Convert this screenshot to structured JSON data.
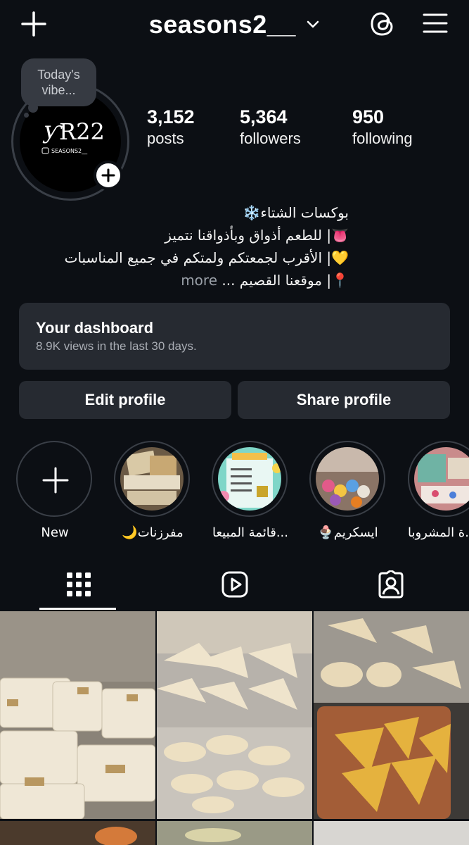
{
  "header": {
    "username": "seasons2__",
    "icons": [
      "plus-icon",
      "chevron-down-icon",
      "threads-icon",
      "menu-icon"
    ]
  },
  "profile": {
    "note": "Today's vibe...",
    "logo_text": "R22",
    "logo_subtext": "SEASONS2__",
    "stats": [
      {
        "value": "3,152",
        "label": "posts"
      },
      {
        "value": "5,364",
        "label": "followers"
      },
      {
        "value": "950",
        "label": "following"
      }
    ]
  },
  "bio": {
    "line1": "بوكسات الشتاء❄️",
    "line2": "👅| للطعم أذواق وبأذواقنا نتميز",
    "line3": "💛| الأقرب لجمعتكم ولمتكم في جميع المناسبات",
    "line4": "📍| موقعنا القصيم ...",
    "more": "more"
  },
  "dashboard": {
    "title": "Your dashboard",
    "subtitle": "8.9K views in the last 30 days."
  },
  "buttons": {
    "edit": "Edit profile",
    "share": "Share profile"
  },
  "highlights": [
    {
      "label": "New"
    },
    {
      "label": "🌙مفرزنات"
    },
    {
      "label": "قائمة المبيعا..."
    },
    {
      "label": "🍨ايسكريم"
    },
    {
      "label": "ة المشروبا..."
    }
  ],
  "tabs": [
    "grid-icon",
    "reels-icon",
    "tagged-icon"
  ],
  "colors": {
    "background": "#0c0f14",
    "card": "#262a31",
    "muted_text": "#a9adb4"
  }
}
